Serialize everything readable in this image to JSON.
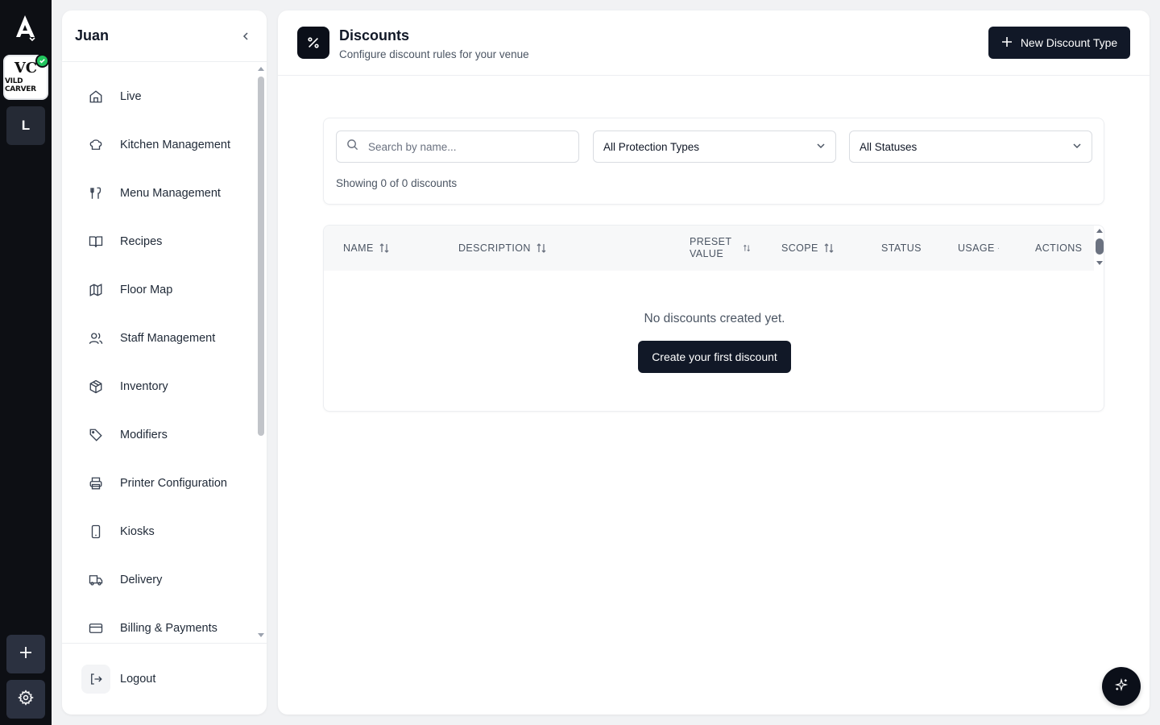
{
  "rail": {
    "venue_monogram": "VC",
    "venue_name": "VILD CARVER",
    "workspace_letter": "L",
    "icons": [
      "app-logo-icon",
      "add-icon",
      "settings-icon"
    ]
  },
  "sidebar": {
    "title": "Juan",
    "items": [
      {
        "label": "Live",
        "icon": "home-icon"
      },
      {
        "label": "Kitchen Management",
        "icon": "chef-hat-icon"
      },
      {
        "label": "Menu Management",
        "icon": "utensils-icon"
      },
      {
        "label": "Recipes",
        "icon": "book-icon"
      },
      {
        "label": "Floor Map",
        "icon": "map-icon"
      },
      {
        "label": "Staff Management",
        "icon": "users-icon"
      },
      {
        "label": "Inventory",
        "icon": "package-icon"
      },
      {
        "label": "Modifiers",
        "icon": "tag-icon"
      },
      {
        "label": "Printer Configuration",
        "icon": "printer-icon"
      },
      {
        "label": "Kiosks",
        "icon": "tablet-icon"
      },
      {
        "label": "Delivery",
        "icon": "truck-icon"
      },
      {
        "label": "Billing & Payments",
        "icon": "credit-card-icon"
      }
    ],
    "logout_label": "Logout"
  },
  "header": {
    "title": "Discounts",
    "subtitle": "Configure discount rules for your venue",
    "new_button_label": "New Discount Type"
  },
  "filters": {
    "search_placeholder": "Search by name...",
    "protection_type": "All Protection Types",
    "status": "All Statuses",
    "showing_text": "Showing 0 of 0 discounts"
  },
  "table": {
    "columns": {
      "name": "NAME",
      "description": "DESCRIPTION",
      "preset_value_line1": "PRESET",
      "preset_value_line2": "VALUE",
      "scope": "SCOPE",
      "status": "STATUS",
      "usage": "USAGE",
      "actions": "ACTIONS"
    },
    "empty_text": "No discounts created yet.",
    "create_button_label": "Create your first discount"
  },
  "colors": {
    "rail_bg": "#0d0f14",
    "primary_dark": "#111827",
    "success": "#22c55e"
  }
}
